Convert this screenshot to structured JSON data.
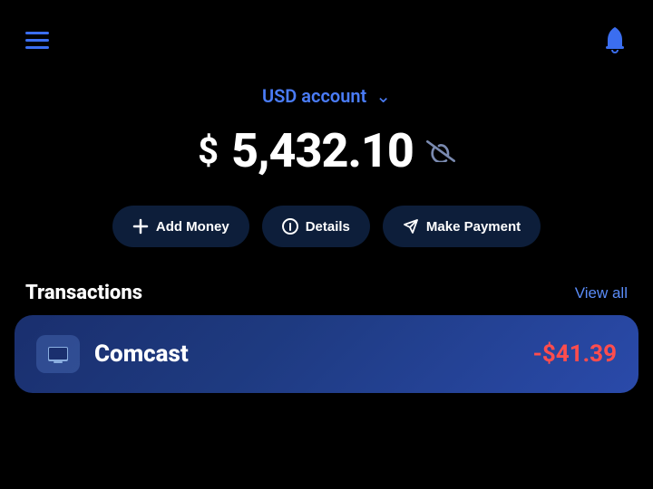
{
  "header": {
    "menu_label": "Menu",
    "notification_label": "Notifications"
  },
  "account": {
    "selector_label": "USD account",
    "currency_symbol": "$",
    "balance": "5,432.10",
    "visibility_label": "Hide balance"
  },
  "actions": [
    {
      "id": "add-money",
      "label": "Add Money",
      "icon": "plus"
    },
    {
      "id": "details",
      "label": "Details",
      "icon": "info"
    },
    {
      "id": "make-payment",
      "label": "Make Payment",
      "icon": "send"
    }
  ],
  "transactions": {
    "title": "Transactions",
    "view_all_label": "View all",
    "items": [
      {
        "id": "comcast",
        "name": "Comcast",
        "amount": "-$41.39",
        "type": "debit"
      }
    ]
  }
}
